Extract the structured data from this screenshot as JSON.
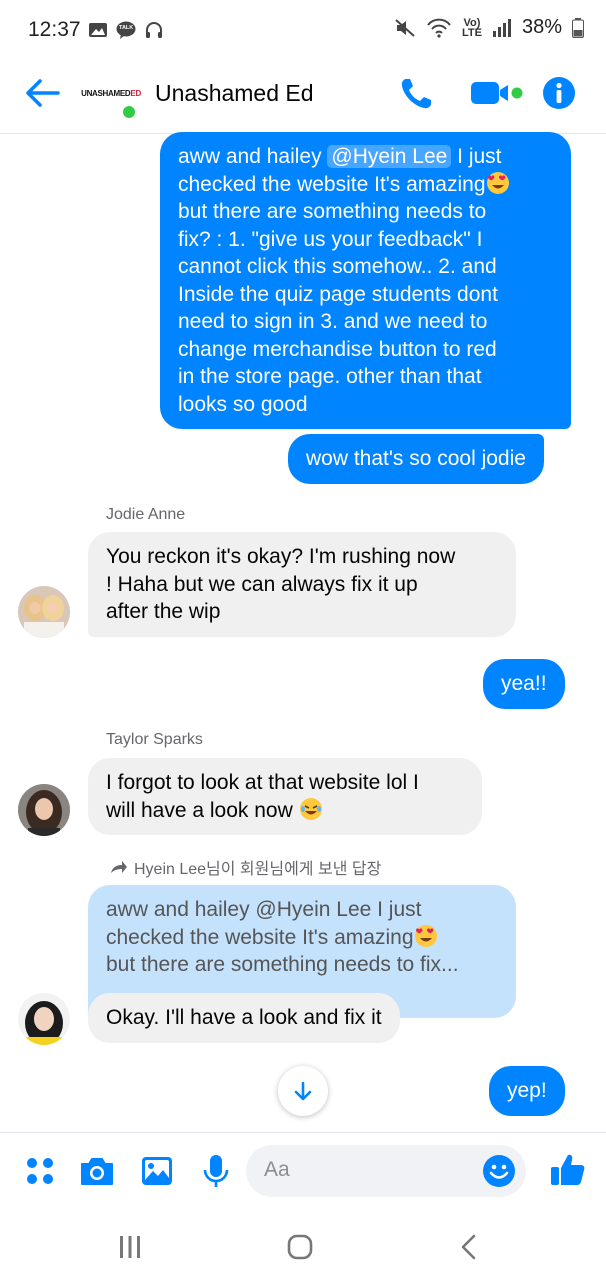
{
  "status_bar": {
    "time": "12:37",
    "battery": "38%",
    "talk_badge": "TALK",
    "volte": "Vo)",
    "lte": "LTE"
  },
  "header": {
    "contact_name": "Unashamed Ed",
    "logo_text_main": "UNASHAMED",
    "logo_text_accent": "ED",
    "online": true
  },
  "messages": [
    {
      "direction": "outgoing",
      "text_before_mention": "aww and hailey ",
      "mention": "@Hyein Lee",
      "lines": [
        " I just",
        "checked the website It's amazing",
        "but there are something needs to",
        "fix? : 1. \"give us your feedback\" I",
        "cannot click this somehow.. 2. and",
        "Inside the quiz page students dont",
        "need to sign in 3. and we need to",
        "change merchandise button to red",
        "in the store page. other than that",
        "looks so good"
      ]
    },
    {
      "direction": "outgoing",
      "text": "wow that's so cool jodie"
    },
    {
      "direction": "incoming",
      "sender": "Jodie Anne",
      "lines": [
        "You reckon it's okay? I'm rushing now",
        "! Haha but we can always fix it up",
        "after the wip"
      ]
    },
    {
      "direction": "outgoing",
      "text": "yea!!"
    },
    {
      "direction": "incoming",
      "sender": "Taylor Sparks",
      "lines": [
        "I forgot to look at that website lol I",
        "will have a look now"
      ]
    },
    {
      "direction": "incoming",
      "reply_label": "Hyein Lee님이 회원님에게 보낸 답장",
      "quoted_lines": [
        "aww and hailey @Hyein Lee  I just",
        "checked the website It's amazing",
        "but there are something needs to fix..."
      ],
      "text": "Okay. I'll have a look and fix it"
    },
    {
      "direction": "outgoing",
      "text": "yep!"
    }
  ],
  "composer": {
    "placeholder": "Aa"
  },
  "colors": {
    "accent": "#0084ff",
    "incoming_bubble": "#f0f0f0",
    "reply_bubble": "#c5e2fd",
    "online": "#31cc46"
  },
  "icons": [
    "back-arrow-icon",
    "phone-icon",
    "video-icon",
    "info-icon",
    "apps-icon",
    "camera-icon",
    "gallery-icon",
    "microphone-icon",
    "emoji-icon",
    "thumbs-up-icon",
    "scroll-down-icon",
    "reply-arrow-icon",
    "recent-apps-icon",
    "home-icon",
    "back-nav-icon"
  ]
}
